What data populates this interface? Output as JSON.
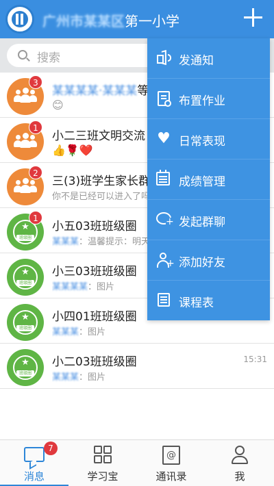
{
  "header": {
    "title_blurred": "广州市某某区",
    "title": "第一小学"
  },
  "search": {
    "placeholder": "搜索"
  },
  "chats": [
    {
      "avatar": "group",
      "badge": "3",
      "name_blurred": "某某某某·某某某",
      "name": "等",
      "sub": "😊",
      "sub_blurred": "",
      "time": ""
    },
    {
      "avatar": "group",
      "badge": "1",
      "name_blurred": "",
      "name": "小二三班文明交流",
      "sub": "👍🌹❤️",
      "sub_blurred": "",
      "time": ""
    },
    {
      "avatar": "group",
      "badge": "2",
      "name_blurred": "",
      "name": "三(3)班学生家长群",
      "sub": "你不是已经可以进入了吗",
      "sub_blurred": "",
      "time": ""
    },
    {
      "avatar": "class",
      "badge": "1",
      "name_blurred": "",
      "name": "小五03班班级圈",
      "sub": "：温馨提示：明天",
      "sub_blurred": "某某某",
      "time": ""
    },
    {
      "avatar": "class",
      "badge": "",
      "name_blurred": "",
      "name": "小三03班班级圈",
      "sub": "：图片",
      "sub_blurred": "某某某某",
      "time": ""
    },
    {
      "avatar": "class",
      "badge": "",
      "name_blurred": "",
      "name": "小四01班班级圈",
      "sub": "：图片",
      "sub_blurred": "某某某",
      "time": ""
    },
    {
      "avatar": "class",
      "badge": "",
      "name_blurred": "",
      "name": "小二03班班级圈",
      "sub": "：图片",
      "sub_blurred": "某某某",
      "time": "15:31"
    }
  ],
  "class_avatar_label": "班级圈",
  "menu": [
    {
      "icon": "megaphone-icon",
      "label": "发通知"
    },
    {
      "icon": "homework-icon",
      "label": "布置作业"
    },
    {
      "icon": "heart-icon",
      "label": "日常表现"
    },
    {
      "icon": "grades-icon",
      "label": "成绩管理"
    },
    {
      "icon": "group-chat-icon",
      "label": "发起群聊"
    },
    {
      "icon": "add-friend-icon",
      "label": "添加好友"
    },
    {
      "icon": "schedule-icon",
      "label": "课程表"
    }
  ],
  "bottom_nav": [
    {
      "icon": "message-icon",
      "label": "消息",
      "badge": "7",
      "active": true
    },
    {
      "icon": "grid-icon",
      "label": "学习宝",
      "badge": "",
      "active": false
    },
    {
      "icon": "contacts-icon",
      "label": "通讯录",
      "badge": "",
      "active": false
    },
    {
      "icon": "profile-icon",
      "label": "我",
      "badge": "",
      "active": false
    }
  ],
  "colors": {
    "header_bg": "#3a8ee0",
    "menu_bg": "#3e93e2",
    "badge": "#e0393e",
    "group_avatar": "#ee8a3a",
    "class_avatar": "#5fb545",
    "active_nav": "#2d86d8"
  }
}
